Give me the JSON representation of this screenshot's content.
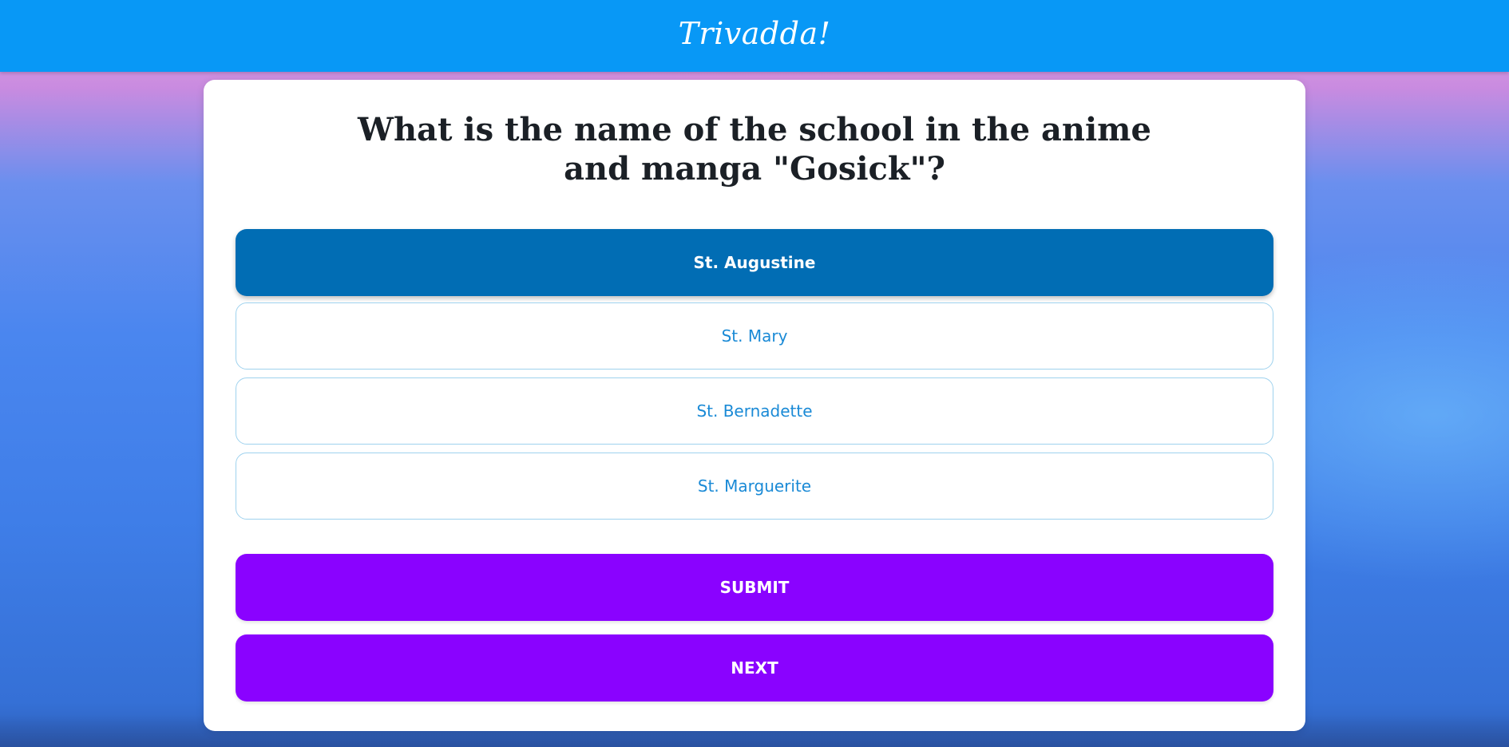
{
  "app": {
    "brand": "Trivadda!"
  },
  "quiz": {
    "question": "What is the name of the school in the anime and manga \"Gosick\"?",
    "options": [
      {
        "label": "St. Augustine",
        "selected": true
      },
      {
        "label": "St. Mary",
        "selected": false
      },
      {
        "label": "St. Bernadette",
        "selected": false
      },
      {
        "label": "St. Marguerite",
        "selected": false
      }
    ],
    "submit_label": "SUBMIT",
    "next_label": "NEXT"
  },
  "colors": {
    "header": "#0898f6",
    "selected_option": "#016db4",
    "option_text": "#1a8ad6",
    "action_button": "#8a02ff"
  }
}
